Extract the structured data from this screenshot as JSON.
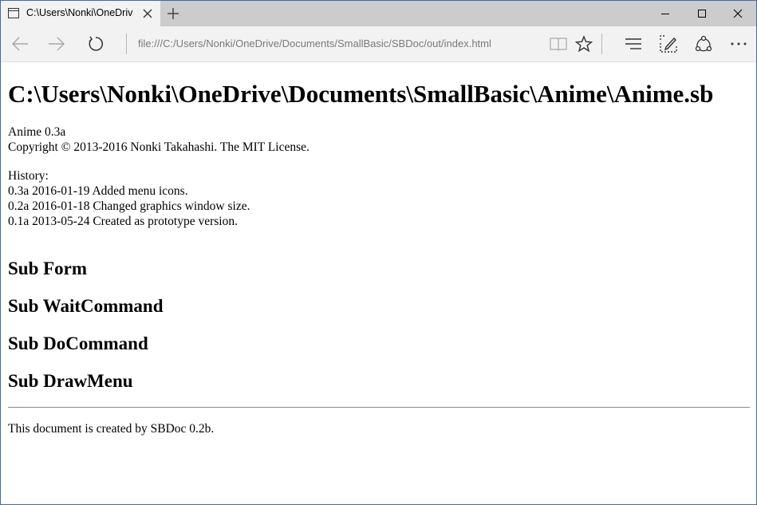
{
  "browser": {
    "tab_title": "C:\\Users\\Nonki\\OneDriv",
    "address": "file:///C:/Users/Nonki/OneDrive/Documents/SmallBasic/SBDoc/out/index.html",
    "toolbar_icons": [
      "back-icon",
      "forward-icon",
      "refresh-icon",
      "reading-view-icon",
      "favorite-star-icon",
      "hub-icon",
      "web-note-icon",
      "share-icon",
      "more-icon"
    ],
    "window_icons": [
      "minimize-icon",
      "maximize-icon",
      "close-icon"
    ]
  },
  "page": {
    "title": "C:\\Users\\Nonki\\OneDrive\\Documents\\SmallBasic\\Anime\\Anime.sb",
    "intro_lines": [
      "Anime 0.3a",
      "Copyright © 2013-2016 Nonki Takahashi. The MIT License."
    ],
    "history_lines": [
      "History:",
      "0.3a 2016-01-19 Added menu icons.",
      "0.2a 2016-01-18 Changed graphics window size.",
      "0.1a 2013-05-24 Created as prototype version."
    ],
    "subs": [
      "Sub Form",
      "Sub WaitCommand",
      "Sub DoCommand",
      "Sub DrawMenu"
    ],
    "footer": "This document is created by SBDoc 0.2b."
  }
}
